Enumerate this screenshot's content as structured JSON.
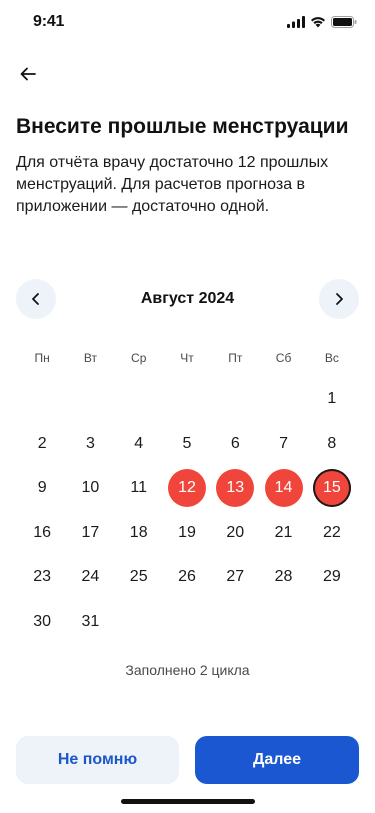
{
  "status_bar": {
    "time": "9:41"
  },
  "title": "Внесите прошлые менструации",
  "description": "Для отчёта врачу достаточно 12 прошлых менструаций. Для расчетов прогноза в приложении — достаточно одной.",
  "calendar": {
    "month": "Август 2024",
    "weekdays": [
      "Пн",
      "Вт",
      "Ср",
      "Чт",
      "Пт",
      "Сб",
      "Вс"
    ],
    "leading_blanks": 6,
    "days": [
      "1",
      "2",
      "3",
      "4",
      "5",
      "6",
      "7",
      "8",
      "9",
      "10",
      "11",
      "12",
      "13",
      "14",
      "15",
      "16",
      "17",
      "18",
      "19",
      "20",
      "21",
      "22",
      "23",
      "24",
      "25",
      "26",
      "27",
      "28",
      "29",
      "30",
      "31"
    ],
    "selected_days": [
      "12",
      "13",
      "14",
      "15"
    ],
    "today": "15",
    "selected_color": "#f0453a"
  },
  "status_text": "Заполнено 2 цикла",
  "buttons": {
    "secondary": "Не помню",
    "primary": "Далее"
  },
  "colors": {
    "primary": "#1b57d1",
    "secondary_bg": "#eef2f9",
    "accent_red": "#f0453a"
  }
}
